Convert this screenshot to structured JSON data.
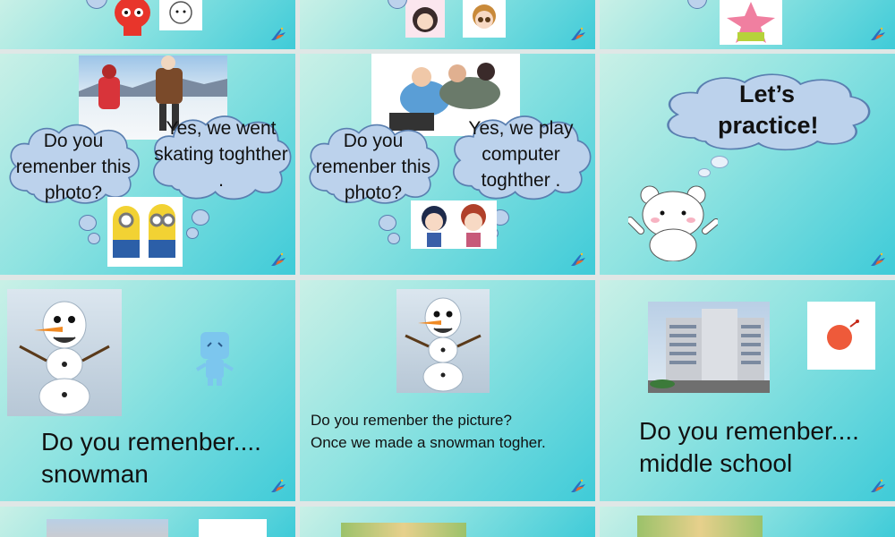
{
  "slides": {
    "s4": {
      "cloud_left_text": "Do you remenber this photo?",
      "cloud_right_text": "Yes, we went skating toghther ."
    },
    "s5": {
      "cloud_left_text": "Do you remenber this photo?",
      "cloud_right_text": "Yes, we play computer toghther ."
    },
    "s6": {
      "cloud_text": "Let’s practice!"
    },
    "s7": {
      "main_line1": "Do you remenber....",
      "main_line2": "snowman"
    },
    "s8": {
      "line1": "Do you remenber the picture?",
      "line2": "Once we made a snowman togher."
    },
    "s9": {
      "main_line1": "Do you remenber....",
      "main_line2": "middle school"
    }
  },
  "icons": {
    "corner": "bird-logo-icon",
    "cloud": "thought-cloud-icon"
  },
  "colors": {
    "slide_gradient_start": "#c9f0e6",
    "slide_gradient_end": "#3fcbd8",
    "cloud_fill": "#bcd2ec",
    "cloud_stroke": "#5a7fb0",
    "page_background": "#dfe7e6"
  }
}
